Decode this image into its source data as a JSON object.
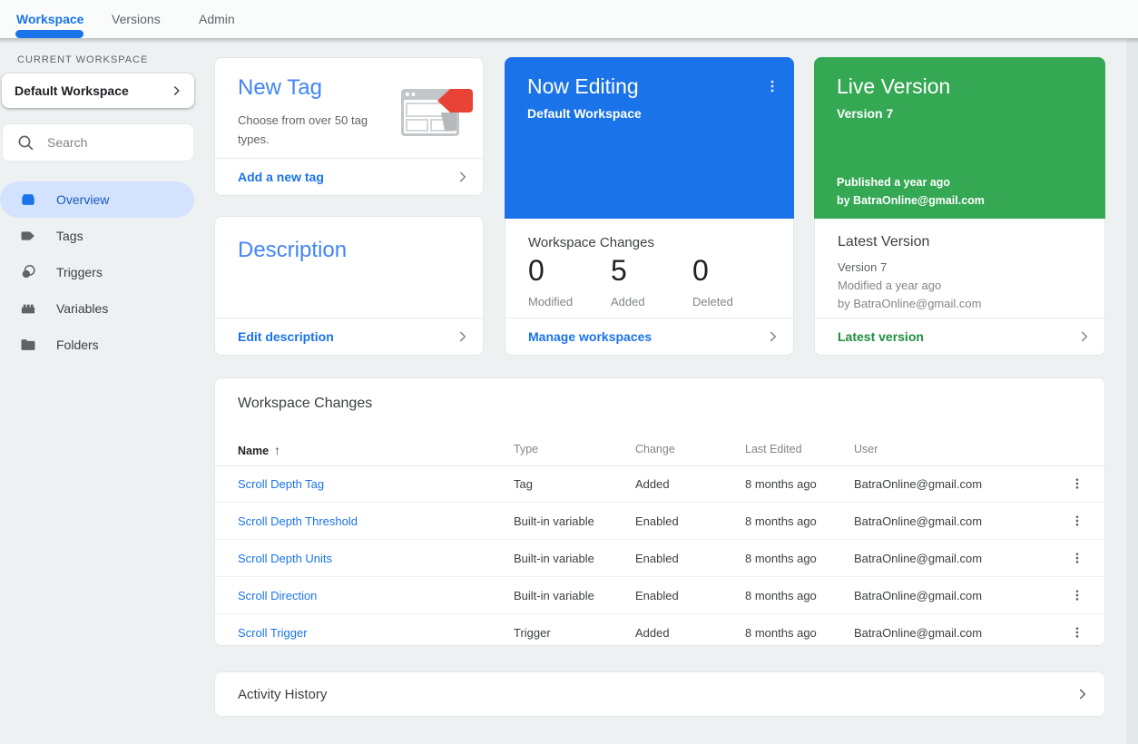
{
  "nav": {
    "tabs": [
      {
        "label": "Workspace",
        "active": true
      },
      {
        "label": "Versions",
        "active": false
      },
      {
        "label": "Admin",
        "active": false
      }
    ]
  },
  "sidebar": {
    "section_label": "CURRENT WORKSPACE",
    "workspace_selector": "Default Workspace",
    "search_placeholder": "Search",
    "items": [
      {
        "label": "Overview",
        "icon": "overview-icon",
        "active": true
      },
      {
        "label": "Tags",
        "icon": "tags-icon",
        "active": false
      },
      {
        "label": "Triggers",
        "icon": "triggers-icon",
        "active": false
      },
      {
        "label": "Variables",
        "icon": "variables-icon",
        "active": false
      },
      {
        "label": "Folders",
        "icon": "folders-icon",
        "active": false
      }
    ]
  },
  "cards": {
    "new_tag": {
      "title": "New Tag",
      "subtitle": "Choose from over 50 tag types.",
      "footer_link": "Add a new tag"
    },
    "description": {
      "title": "Description",
      "footer_link": "Edit description"
    },
    "now_editing": {
      "title": "Now Editing",
      "subtitle": "Default Workspace",
      "section_title": "Workspace Changes",
      "stats": [
        {
          "value": "0",
          "label": "Modified"
        },
        {
          "value": "5",
          "label": "Added"
        },
        {
          "value": "0",
          "label": "Deleted"
        }
      ],
      "footer_link": "Manage workspaces"
    },
    "live_version": {
      "title": "Live Version",
      "subtitle": "Version 7",
      "published": "Published a year ago",
      "published_by": "by BatraOnline@gmail.com",
      "latest_heading": "Latest Version",
      "latest_version": "Version 7",
      "latest_modified": "Modified a year ago",
      "latest_by": "by BatraOnline@gmail.com",
      "footer_link": "Latest version"
    }
  },
  "changes_table": {
    "title": "Workspace Changes",
    "columns": [
      "Name",
      "Type",
      "Change",
      "Last Edited",
      "User"
    ],
    "sort_icon": "↑",
    "rows": [
      {
        "name": "Scroll Depth Tag",
        "type": "Tag",
        "change": "Added",
        "last_edited": "8 months ago",
        "user": "BatraOnline@gmail.com"
      },
      {
        "name": "Scroll Depth Threshold",
        "type": "Built-in variable",
        "change": "Enabled",
        "last_edited": "8 months ago",
        "user": "BatraOnline@gmail.com"
      },
      {
        "name": "Scroll Depth Units",
        "type": "Built-in variable",
        "change": "Enabled",
        "last_edited": "8 months ago",
        "user": "BatraOnline@gmail.com"
      },
      {
        "name": "Scroll Direction",
        "type": "Built-in variable",
        "change": "Enabled",
        "last_edited": "8 months ago",
        "user": "BatraOnline@gmail.com"
      },
      {
        "name": "Scroll Trigger",
        "type": "Trigger",
        "change": "Added",
        "last_edited": "8 months ago",
        "user": "BatraOnline@gmail.com"
      }
    ]
  },
  "activity": {
    "title": "Activity History"
  },
  "icons": {
    "search": "magnifier",
    "chevron_right": "›",
    "kebab_menu": "⋮",
    "sort_ascending": "↑"
  },
  "colors": {
    "accent_blue": "#1a73e8",
    "card_title_blue": "#4285f4",
    "live_green": "#34a853",
    "green_link": "#1e8e3e",
    "tag_red": "#e94335",
    "active_pill": "#d3e3fd"
  }
}
